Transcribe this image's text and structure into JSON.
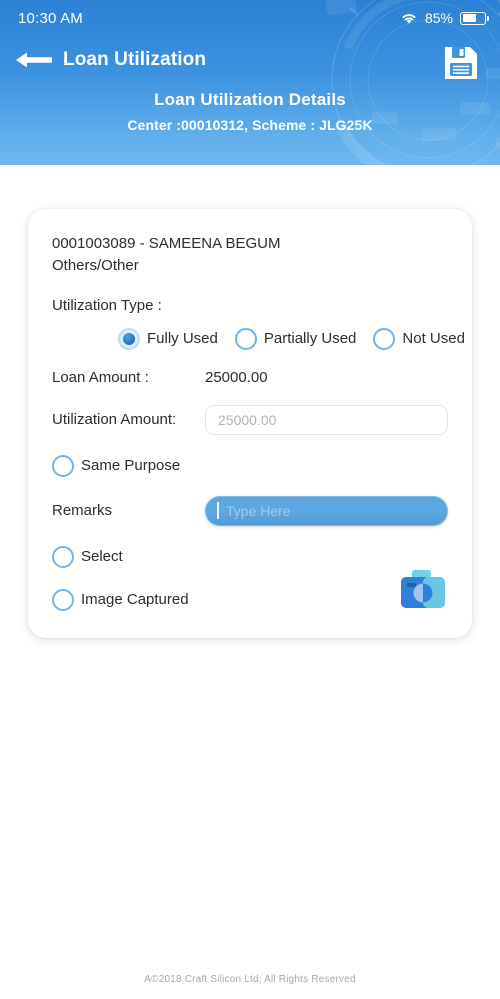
{
  "statusbar": {
    "time": "10:30 AM",
    "battery_percent": "85%",
    "wifi_icon": "wifi-icon",
    "battery_icon": "battery-icon"
  },
  "header": {
    "back_icon": "back-arrow-icon",
    "nav_title": "Loan Utilization",
    "save_icon": "save-floppy-icon",
    "page_title": "Loan Utilization Details",
    "page_meta": "Center :00010312, Scheme : JLG25K",
    "gradient_top": "#2b80d4",
    "gradient_bottom": "#6fb7ef"
  },
  "card": {
    "client_id_name": "0001003089 - SAMEENA BEGUM",
    "client_category": "Others/Other",
    "utilization_type_label": "Utilization Type :",
    "utilization_options": [
      {
        "label": "Fully Used",
        "selected": true
      },
      {
        "label": "Partially Used",
        "selected": false
      },
      {
        "label": "Not Used",
        "selected": false
      }
    ],
    "loan_amount_label": "Loan Amount :",
    "loan_amount_value": "25000.00",
    "utilization_amount_label": "Utilization Amount:",
    "utilization_amount_placeholder": "25000.00",
    "same_purpose_label": "Same Purpose",
    "same_purpose_checked": false,
    "remarks_label": "Remarks",
    "remarks_placeholder": "Type Here",
    "remarks_value": "",
    "select_label": "Select",
    "select_checked": false,
    "image_captured_label": "Image Captured",
    "image_captured_checked": false,
    "camera_icon": "camera-icon",
    "accent_color": "#72b4e8",
    "remarks_field_color": "#5aa5dd"
  },
  "footer": {
    "copyright": "A©2018 Craft Silicon Ltd; All Rights Reserved"
  }
}
